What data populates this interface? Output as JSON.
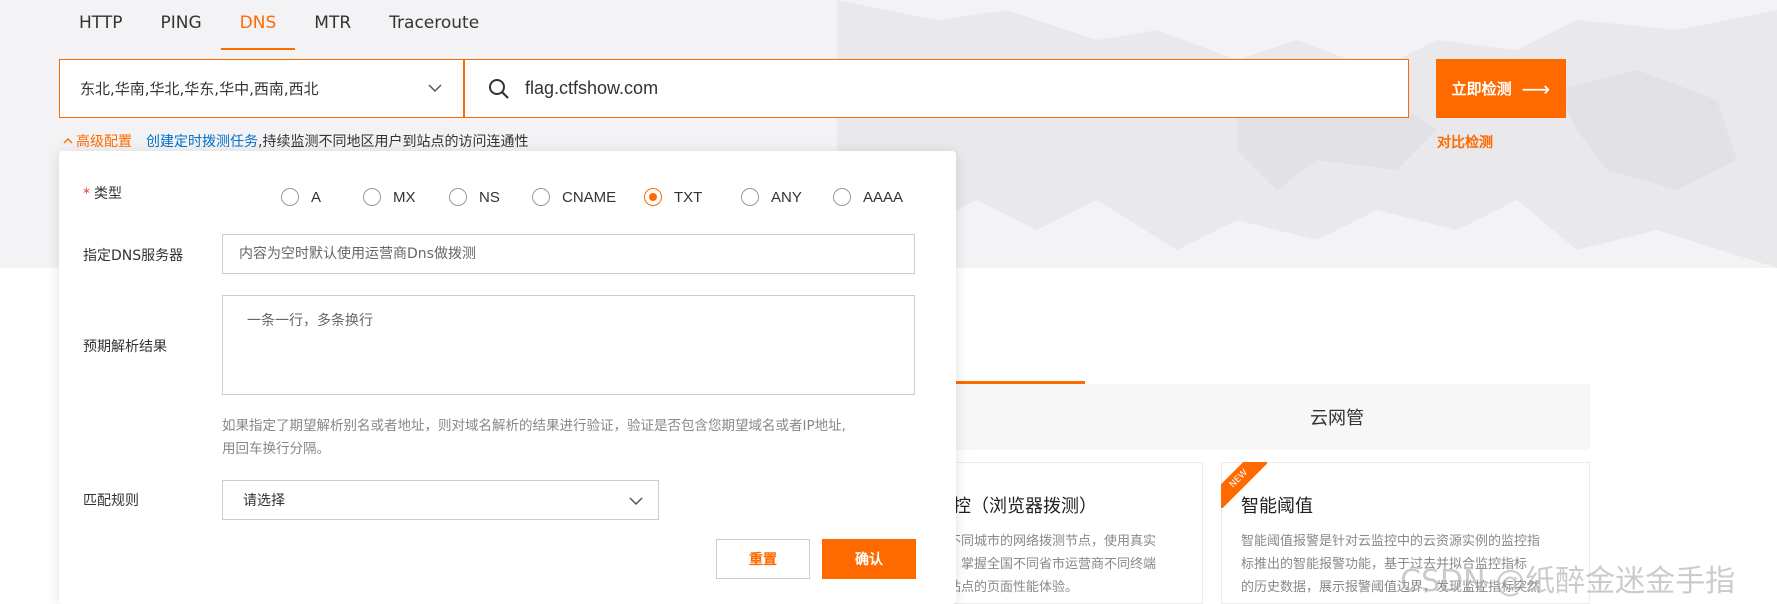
{
  "tabs": [
    {
      "label": "HTTP"
    },
    {
      "label": "PING"
    },
    {
      "label": "DNS",
      "active": true
    },
    {
      "label": "MTR"
    },
    {
      "label": "Traceroute"
    }
  ],
  "region_select": {
    "value": "东北,华南,华北,华东,华中,西南,西北"
  },
  "domain_input": {
    "value": "flag.ctfshow.com",
    "icon": "search-icon"
  },
  "check_button": {
    "label": "立即检测",
    "arrow": "⟶"
  },
  "advanced": {
    "toggle_label": "高级配置",
    "link_label": "创建定时拨测任务",
    "text": ",持续监测不同地区用户到站点的访问连通性"
  },
  "compare_link": "对比检测",
  "panel": {
    "type_label": "类型",
    "required_mark": "*",
    "record_types": [
      "A",
      "MX",
      "NS",
      "CNAME",
      "TXT",
      "ANY",
      "AAAA"
    ],
    "selected_type": "TXT",
    "dns_server_label": "指定DNS服务器",
    "dns_server_placeholder": "内容为空时默认使用运营商Dns做拨测",
    "expected_label": "预期解析结果",
    "expected_placeholder": "一条一行，多条换行",
    "hint_line1": "如果指定了期望解析别名或者地址，则对域名解析的结果进行验证，验证是否包含您期望域名或者IP地址,",
    "hint_line2": "用回车换行分隔。",
    "match_label": "匹配规则",
    "match_placeholder": "请选择",
    "reset_label": "重置",
    "confirm_label": "确认"
  },
  "background": {
    "tab_yun": "云网管",
    "card1_title": "监控（浏览器拨测）",
    "card1_desc": [
      "国不同城市的网络拨测节点，使用真实",
      "点，掌握全国不同省市运营商不同终端",
      "对站点的页面性能体验。"
    ],
    "card2_badge": "NEW",
    "card2_title": "智能阈值",
    "card2_desc": [
      "智能阈值报警是针对云监控中的云资源实例的监控指",
      "标推出的智能报警功能，基于过去并拟合监控指标",
      "的历史数据，展示报警阈值边界，发现监控指标突然"
    ],
    "watermark": "CSDN @纸醉金迷金手指"
  },
  "colors": {
    "accent": "#ff6a00",
    "link": "#0070cc",
    "required": "#e53935"
  }
}
